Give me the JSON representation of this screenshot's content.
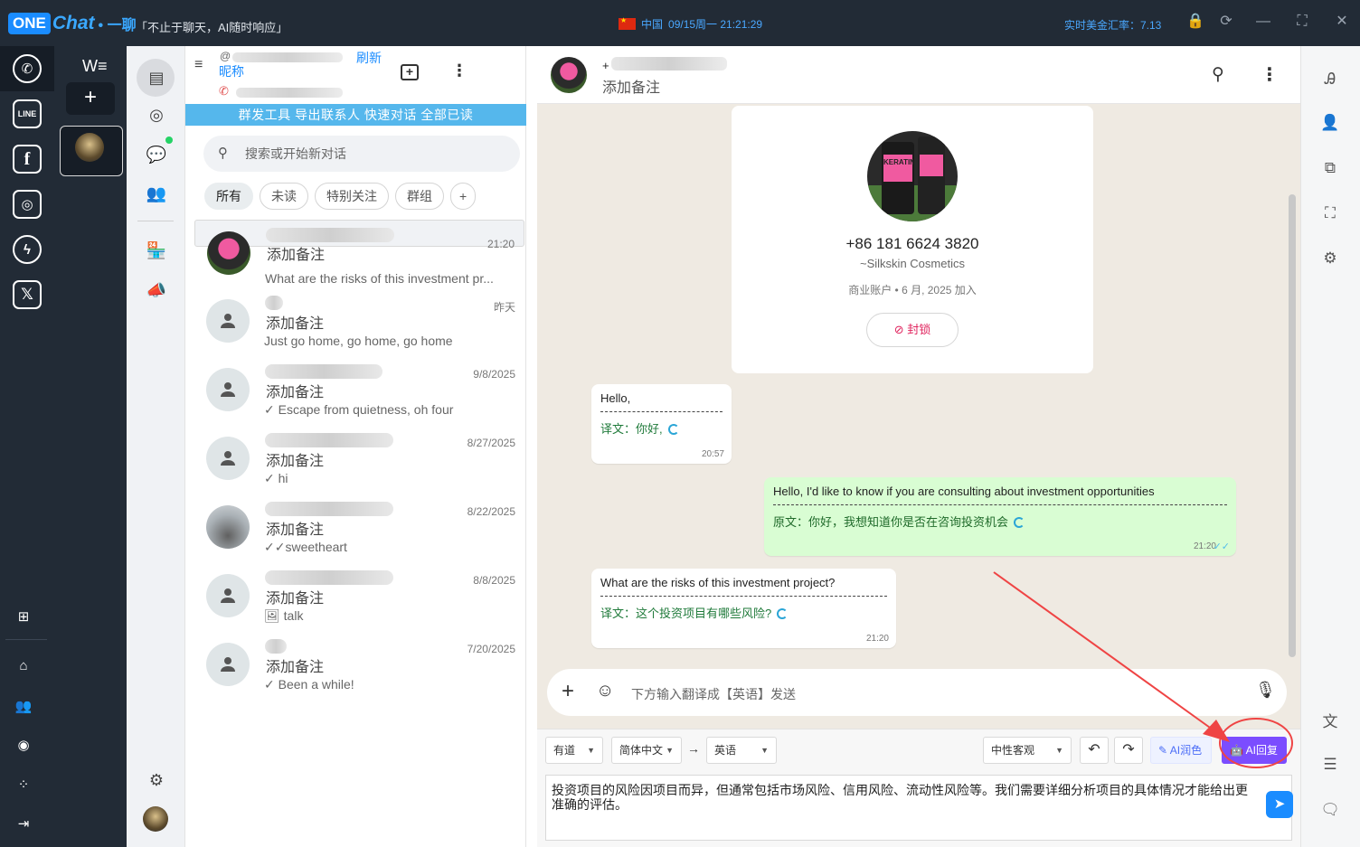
{
  "titlebar": {
    "logo_one": "ONE",
    "logo_chat": "Chat",
    "logo_suffix": "• 一聊",
    "slogan": "「不止于聊天，AI随时响应」",
    "country": "中国",
    "datetime": "09/15周一 21:21:29",
    "rate": "实时美金汇率：7.13"
  },
  "rail": {
    "apps": [
      "whatsapp-icon",
      "line-icon",
      "facebook-icon",
      "instagram-icon",
      "messenger-icon",
      "x-icon"
    ],
    "line_text": "LINE"
  },
  "account": {
    "app_label": "W≡"
  },
  "list": {
    "menu_label": "昵称",
    "refresh": "刷新",
    "toolbar": "群发工具  导出联系人  快速对话  全部已读",
    "search_placeholder": "搜索或开始新对话",
    "filters": [
      "所有",
      "未读",
      "特别关注",
      "群组",
      "+"
    ],
    "chats": [
      {
        "note": "添加备注",
        "msg": "What are the risks of this investment pr...",
        "time": "21:20"
      },
      {
        "note": "添加备注",
        "msg": "Just go home, go home, go home",
        "time": "昨天"
      },
      {
        "note": "添加备注",
        "msg": "✓ Escape from quietness, oh four",
        "time": "9/8/2025"
      },
      {
        "note": "添加备注",
        "msg": "✓ hi",
        "time": "8/27/2025"
      },
      {
        "note": "添加备注",
        "msg": "✓✓sweetheart",
        "time": "8/22/2025"
      },
      {
        "note": "添加备注",
        "msg": "🖼 talk",
        "time": "8/8/2025"
      },
      {
        "note": "添加备注",
        "msg": "✓ Been a while!",
        "time": "7/20/2025"
      }
    ]
  },
  "conversation": {
    "header_prefix": "+",
    "header_note": "添加备注",
    "profile": {
      "phone": "+86 181 6624 3820",
      "name": "~Silkskin Cosmetics",
      "meta": "商业账户 • 6 月, 2025 加入",
      "block": "封锁",
      "product_text": "KERATIN"
    },
    "messages": [
      {
        "text": "Hello,",
        "label": "译文：你好,",
        "time": "20:57"
      },
      {
        "text": "Hello, I'd like to know if you are consulting about investment opportunities",
        "label": "原文：你好，我想知道你是否在咨询投资机会",
        "time": "21:20"
      },
      {
        "text": "What are the risks of this investment project?",
        "label": "译文：这个投资项目有哪些风险?",
        "time": "21:20"
      }
    ],
    "composer_placeholder": "下方输入翻译成【英语】发送",
    "translator": "有道",
    "source_lang": "简体中文",
    "target_lang": "英语",
    "tone": "中性客观",
    "ai_polish": "AI润色",
    "ai_reply": "AI回复",
    "draft": "投资项目的风险因项目而异，但通常包括市场风险、信用风险、流动性风险等。我们需要详细分析项目的具体情况才能给出更准确的评估。"
  },
  "colors": {
    "accent": "#1a8cff",
    "toolbar": "#55b7ec",
    "outgoing": "#d9fdd3",
    "ai": "#7b4dff",
    "annotation": "#ef4444"
  }
}
